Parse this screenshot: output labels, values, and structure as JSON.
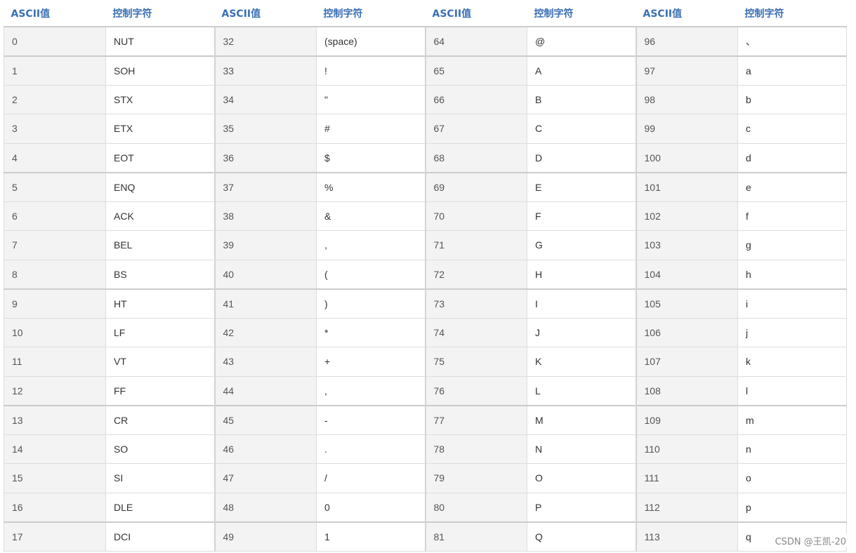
{
  "table": {
    "headers": [
      "ASCII值",
      "控制字符",
      "ASCII值",
      "控制字符",
      "ASCII值",
      "控制字符",
      "ASCII值",
      "控制字符"
    ],
    "group_start_rows": [
      0,
      1,
      5,
      9,
      13,
      17
    ],
    "rows": [
      [
        "0",
        "NUT",
        "32",
        "(space)",
        "64",
        "@",
        "96",
        "、"
      ],
      [
        "1",
        "SOH",
        "33",
        "!",
        "65",
        "A",
        "97",
        "a"
      ],
      [
        "2",
        "STX",
        "34",
        "\"",
        "66",
        "B",
        "98",
        "b"
      ],
      [
        "3",
        "ETX",
        "35",
        "#",
        "67",
        "C",
        "99",
        "c"
      ],
      [
        "4",
        "EOT",
        "36",
        "$",
        "68",
        "D",
        "100",
        "d"
      ],
      [
        "5",
        "ENQ",
        "37",
        "%",
        "69",
        "E",
        "101",
        "e"
      ],
      [
        "6",
        "ACK",
        "38",
        "&",
        "70",
        "F",
        "102",
        "f"
      ],
      [
        "7",
        "BEL",
        "39",
        ",",
        "71",
        "G",
        "103",
        "g"
      ],
      [
        "8",
        "BS",
        "40",
        "(",
        "72",
        "H",
        "104",
        "h"
      ],
      [
        "9",
        "HT",
        "41",
        ")",
        "73",
        "I",
        "105",
        "i"
      ],
      [
        "10",
        "LF",
        "42",
        "*",
        "74",
        "J",
        "106",
        "j"
      ],
      [
        "11",
        "VT",
        "43",
        "+",
        "75",
        "K",
        "107",
        "k"
      ],
      [
        "12",
        "FF",
        "44",
        ",",
        "76",
        "L",
        "108",
        "l"
      ],
      [
        "13",
        "CR",
        "45",
        "-",
        "77",
        "M",
        "109",
        "m"
      ],
      [
        "14",
        "SO",
        "46",
        ".",
        "78",
        "N",
        "110",
        "n"
      ],
      [
        "15",
        "SI",
        "47",
        "/",
        "79",
        "O",
        "111",
        "o"
      ],
      [
        "16",
        "DLE",
        "48",
        "0",
        "80",
        "P",
        "112",
        "p"
      ],
      [
        "17",
        "DCI",
        "49",
        "1",
        "81",
        "Q",
        "113",
        "q"
      ]
    ]
  },
  "watermark": "CSDN @王凯-20"
}
